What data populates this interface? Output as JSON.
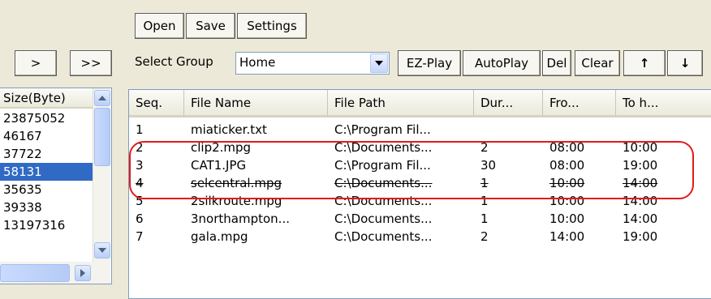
{
  "toolbar": {
    "open_label": "Open",
    "save_label": "Save",
    "settings_label": "Settings",
    "next_label": ">",
    "last_label": ">>"
  },
  "group": {
    "label": "Select Group",
    "selected": "Home"
  },
  "actions": {
    "ez_play": "EZ-Play",
    "autoplay": "AutoPlay",
    "del": "Del",
    "clear": "Clear",
    "move_up": "↑",
    "move_down": "↓"
  },
  "left_list": {
    "header": "Size(Byte)",
    "rows": [
      "23875052",
      "46167",
      "37722",
      "58131",
      "35635",
      "39338",
      "13197316"
    ],
    "selected_index": 3
  },
  "table": {
    "columns": [
      "Seq.",
      "File Name",
      "File Path",
      "Dur...",
      "Fro...",
      "To h..."
    ],
    "rows": [
      [
        "1",
        "miaticker.txt",
        "C:\\Program Fil...",
        "",
        "",
        ""
      ],
      [
        "2",
        "clip2.mpg",
        "C:\\Documents...",
        "2",
        "08:00",
        "10:00"
      ],
      [
        "3",
        "CAT1.JPG",
        "C:\\Program Fil...",
        "30",
        "08:00",
        "19:00"
      ],
      [
        "4",
        "selcentral.mpg",
        "C:\\Documents...",
        "1",
        "10:00",
        "14:00"
      ],
      [
        "5",
        "2silkroute.mpg",
        "C:\\Documents...",
        "1",
        "10:00",
        "14:00"
      ],
      [
        "6",
        "3northampton...",
        "C:\\Documents...",
        "1",
        "10:00",
        "14:00"
      ],
      [
        "7",
        "gala.mpg",
        "C:\\Documents...",
        "2",
        "14:00",
        "19:00"
      ]
    ],
    "struck_row": 3,
    "highlighted_rows": [
      1,
      2,
      3
    ]
  },
  "colors": {
    "highlight": "#e31a1a",
    "selection": "#316ac5",
    "background": "#ece9d8"
  }
}
